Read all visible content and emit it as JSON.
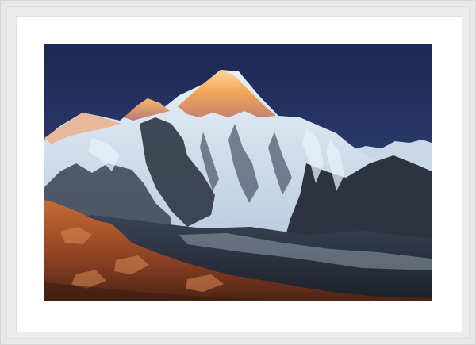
{
  "artwork": {
    "subject": "mountain-peak-at-sunset",
    "colors": {
      "sky_top": "#1f2a55",
      "sky_bottom": "#4a5c8e",
      "alpenglow": "#f0a050",
      "snow": "#dfeaf4",
      "rock_shadow": "#2b3240",
      "foreground_rock": "#b5562a",
      "frame": "#e9e9e9",
      "mat": "#ffffff"
    }
  }
}
